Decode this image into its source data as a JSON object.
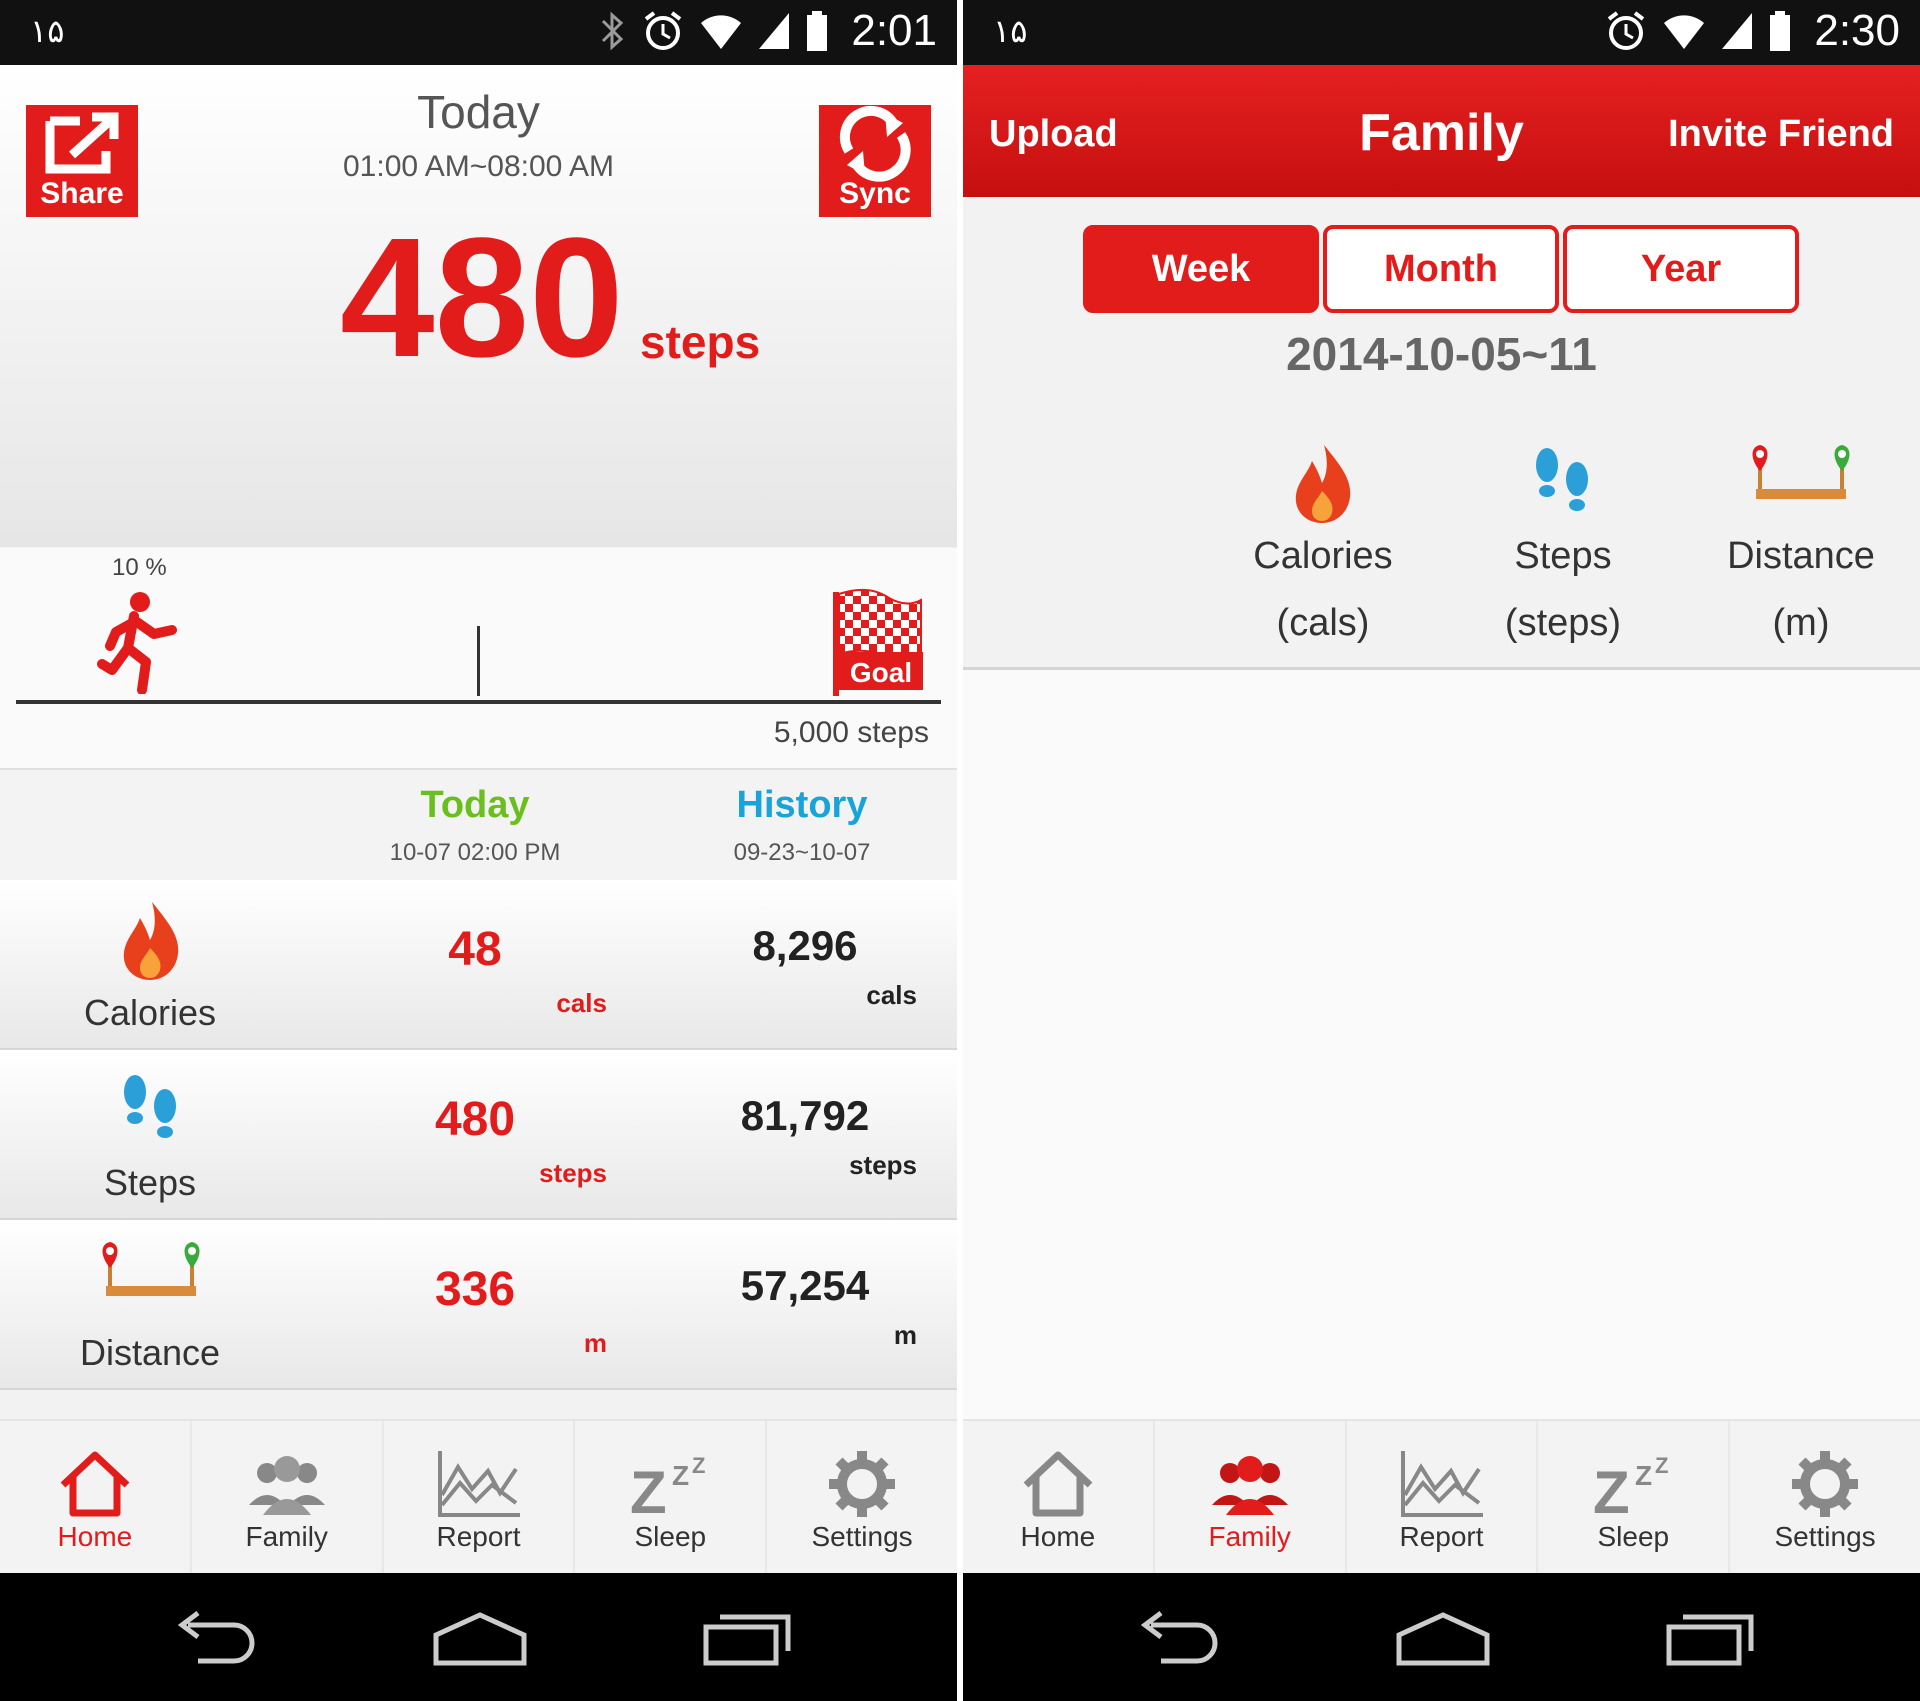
{
  "left": {
    "status": {
      "left_text": "۱۵",
      "time": "2:01"
    },
    "share_label": "Share",
    "sync_label": "Sync",
    "hero": {
      "title": "Today",
      "range": "01:00 AM~08:00 AM",
      "value": "480",
      "unit": "steps"
    },
    "progress": {
      "percent_label": "10 %",
      "percent": 10,
      "goal_label": "Goal",
      "goal_steps": "5,000 steps"
    },
    "compare": {
      "today_title": "Today",
      "today_sub": "10-07 02:00 PM",
      "history_title": "History",
      "history_sub": "09-23~10-07"
    },
    "metrics": [
      {
        "label": "Calories",
        "icon": "flame-icon",
        "today": "48",
        "today_unit": "cals",
        "history": "8,296",
        "history_unit": "cals"
      },
      {
        "label": "Steps",
        "icon": "footprints-icon",
        "today": "480",
        "today_unit": "steps",
        "history": "81,792",
        "history_unit": "steps"
      },
      {
        "label": "Distance",
        "icon": "distance-icon",
        "today": "336",
        "today_unit": "m",
        "history": "57,254",
        "history_unit": "m"
      }
    ],
    "tabs": [
      {
        "label": "Home",
        "icon": "home-icon",
        "active": true
      },
      {
        "label": "Family",
        "icon": "family-icon",
        "active": false
      },
      {
        "label": "Report",
        "icon": "report-icon",
        "active": false
      },
      {
        "label": "Sleep",
        "icon": "sleep-icon",
        "active": false
      },
      {
        "label": "Settings",
        "icon": "gear-icon",
        "active": false
      }
    ]
  },
  "right": {
    "status": {
      "left_text": "۱۵",
      "time": "2:30"
    },
    "header": {
      "upload": "Upload",
      "title": "Family",
      "invite": "Invite Friend"
    },
    "periods": [
      "Week",
      "Month",
      "Year"
    ],
    "active_period": "Week",
    "range": "2014-10-05~11",
    "metrics": [
      {
        "name": "Calories",
        "unit": "(cals)",
        "icon": "flame-icon"
      },
      {
        "name": "Steps",
        "unit": "(steps)",
        "icon": "footprints-icon"
      },
      {
        "name": "Distance",
        "unit": "(m)",
        "icon": "distance-icon"
      }
    ],
    "tabs": [
      {
        "label": "Home",
        "icon": "home-icon",
        "active": false
      },
      {
        "label": "Family",
        "icon": "family-icon",
        "active": true
      },
      {
        "label": "Report",
        "icon": "report-icon",
        "active": false
      },
      {
        "label": "Sleep",
        "icon": "sleep-icon",
        "active": false
      },
      {
        "label": "Settings",
        "icon": "gear-icon",
        "active": false
      }
    ]
  },
  "colors": {
    "accent": "#e21b1b",
    "today_green": "#6abf1e",
    "history_blue": "#1aa3d9"
  }
}
